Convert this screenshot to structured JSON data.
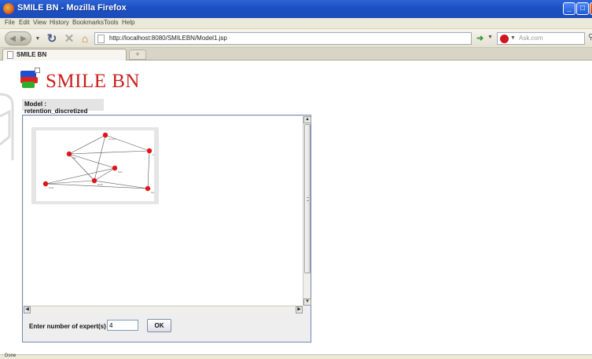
{
  "window": {
    "title": "SMILE BN - Mozilla Firefox"
  },
  "menu": {
    "items": [
      "File",
      "Edit",
      "View",
      "History",
      "Bookmarks",
      "Tools",
      "Help"
    ]
  },
  "navigation": {
    "url": "http://localhost:8080/SMILEBN/Model1.jsp",
    "search_placeholder": "Ask.com"
  },
  "tabs": [
    {
      "label": "SMILE BN",
      "active": true
    }
  ],
  "page": {
    "app_title": "SMILE BN",
    "model_label": "Model : retention_discretized",
    "expert_label": "Enter number of expert(s) :",
    "expert_value": "4",
    "ok_label": "OK"
  },
  "graph": {
    "nodes": [
      {
        "id": "n1",
        "label": "Comm"
      },
      {
        "id": "n2",
        "label": "Fac"
      },
      {
        "id": "n3",
        "label": "Spend"
      },
      {
        "id": "n4",
        "label": "Sub"
      },
      {
        "id": "n5",
        "label": "Rank"
      },
      {
        "id": "n6",
        "label": "Stud"
      },
      {
        "id": "n7",
        "label": "Spent"
      }
    ],
    "edges": [
      [
        "n1",
        "n2"
      ],
      [
        "n1",
        "n3"
      ],
      [
        "n1",
        "n5"
      ],
      [
        "n2",
        "n4"
      ],
      [
        "n2",
        "n5"
      ],
      [
        "n2",
        "n3"
      ],
      [
        "n4",
        "n6"
      ],
      [
        "n4",
        "n5"
      ],
      [
        "n5",
        "n6"
      ],
      [
        "n3",
        "n7"
      ],
      [
        "n6",
        "n7"
      ],
      [
        "n5",
        "n7"
      ]
    ],
    "node_color": "#e0151b"
  },
  "status": {
    "text": "Done"
  }
}
